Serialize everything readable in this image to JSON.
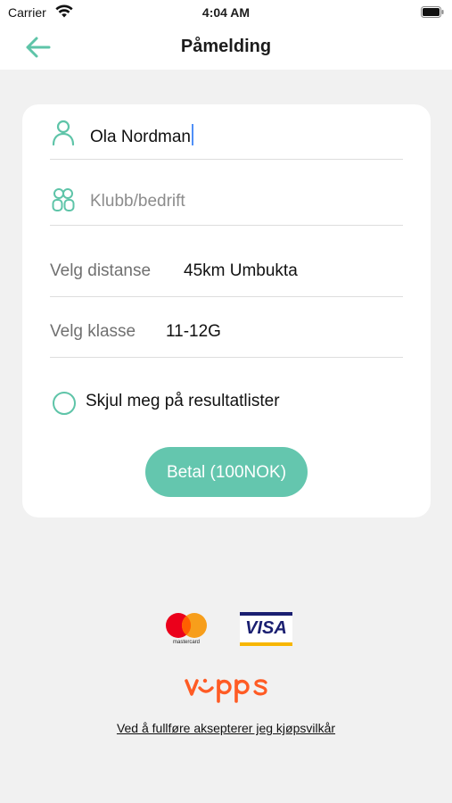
{
  "status_bar": {
    "carrier": "Carrier",
    "time": "4:04 AM"
  },
  "header": {
    "title": "Påmelding",
    "back_icon": "arrow-left-icon"
  },
  "form": {
    "name_value": "Ola Nordman",
    "club_placeholder": "Klubb/bedrift",
    "distance_label": "Velg distanse",
    "distance_value": "45km Umbukta",
    "class_label": "Velg klasse",
    "class_value": "11-12G",
    "hide_label": "Skjul meg på resultatlister",
    "hide_checked": false,
    "pay_button": "Betal (100NOK)"
  },
  "payments": {
    "mastercard_text": "mastercard",
    "visa_text": "VISA",
    "vipps_text": "vipps"
  },
  "terms_link": "Ved å fullføre aksepterer jeg kjøpsvilkår",
  "colors": {
    "accent": "#5ec4a8",
    "button": "#64c6ae",
    "vipps": "#ff5b24",
    "background": "#f1f1f1"
  }
}
